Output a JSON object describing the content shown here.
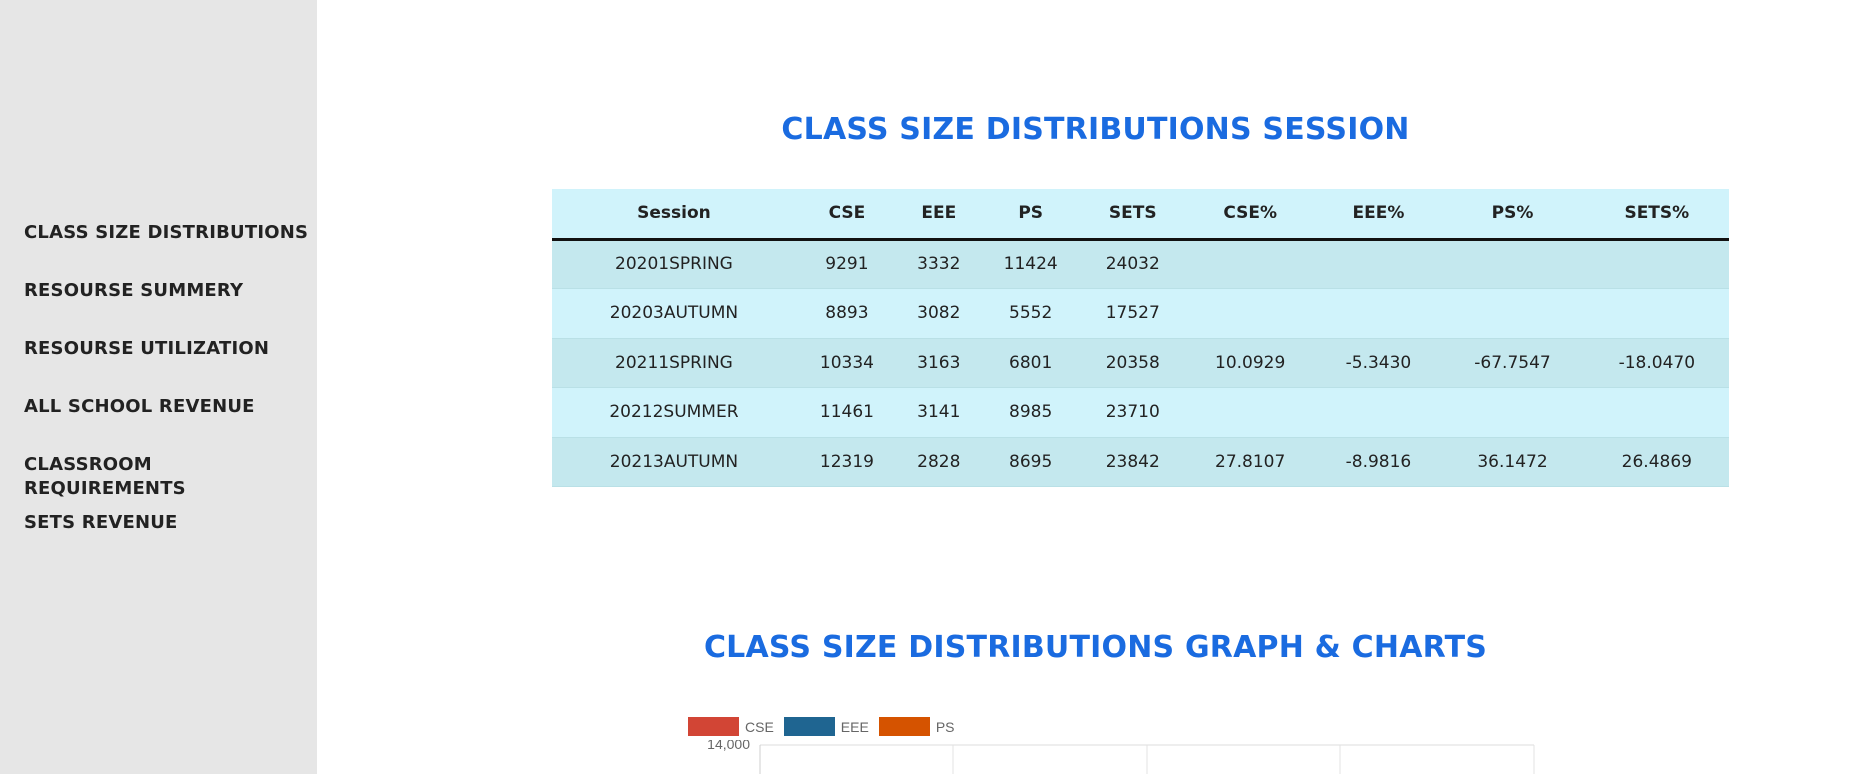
{
  "sidebar": {
    "items": [
      {
        "label": "CLASS SIZE DISTRIBUTIONS"
      },
      {
        "label": "RESOURSE SUMMERY"
      },
      {
        "label": "RESOURSE UTILIZATION"
      },
      {
        "label": "ALL SCHOOL REVENUE"
      },
      {
        "label": "CLASSROOM REQUIREMENTS"
      },
      {
        "label": "SETS REVENUE"
      }
    ]
  },
  "table_section": {
    "title": "CLASS SIZE DISTRIBUTIONS SESSION",
    "headers": [
      "Session",
      "CSE",
      "EEE",
      "PS",
      "SETS",
      "CSE%",
      "EEE%",
      "PS%",
      "SETS%"
    ],
    "rows": [
      [
        "20201SPRING",
        "9291",
        "3332",
        "11424",
        "24032",
        "",
        "",
        "",
        ""
      ],
      [
        "20203AUTUMN",
        "8893",
        "3082",
        "5552",
        "17527",
        "",
        "",
        "",
        ""
      ],
      [
        "20211SPRING",
        "10334",
        "3163",
        "6801",
        "20358",
        "10.0929",
        "-5.3430",
        "-67.7547",
        "-18.0470"
      ],
      [
        "20212SUMMER",
        "11461",
        "3141",
        "8985",
        "23710",
        "",
        "",
        "",
        ""
      ],
      [
        "20213AUTUMN",
        "12319",
        "2828",
        "8695",
        "23842",
        "27.8107",
        "-8.9816",
        "36.1472",
        "26.4869"
      ]
    ]
  },
  "chart_section": {
    "title": "CLASS SIZE DISTRIBUTIONS GRAPH & CHARTS"
  },
  "chart_data": {
    "type": "bar",
    "series": [
      {
        "name": "CSE",
        "color": "#d24535"
      },
      {
        "name": "EEE",
        "color": "#1f6591"
      },
      {
        "name": "PS",
        "color": "#d55300"
      }
    ],
    "y_tick_labels": [
      "14,000"
    ],
    "ylim": [
      null,
      14000
    ],
    "grid": true,
    "legend": "top-center"
  }
}
